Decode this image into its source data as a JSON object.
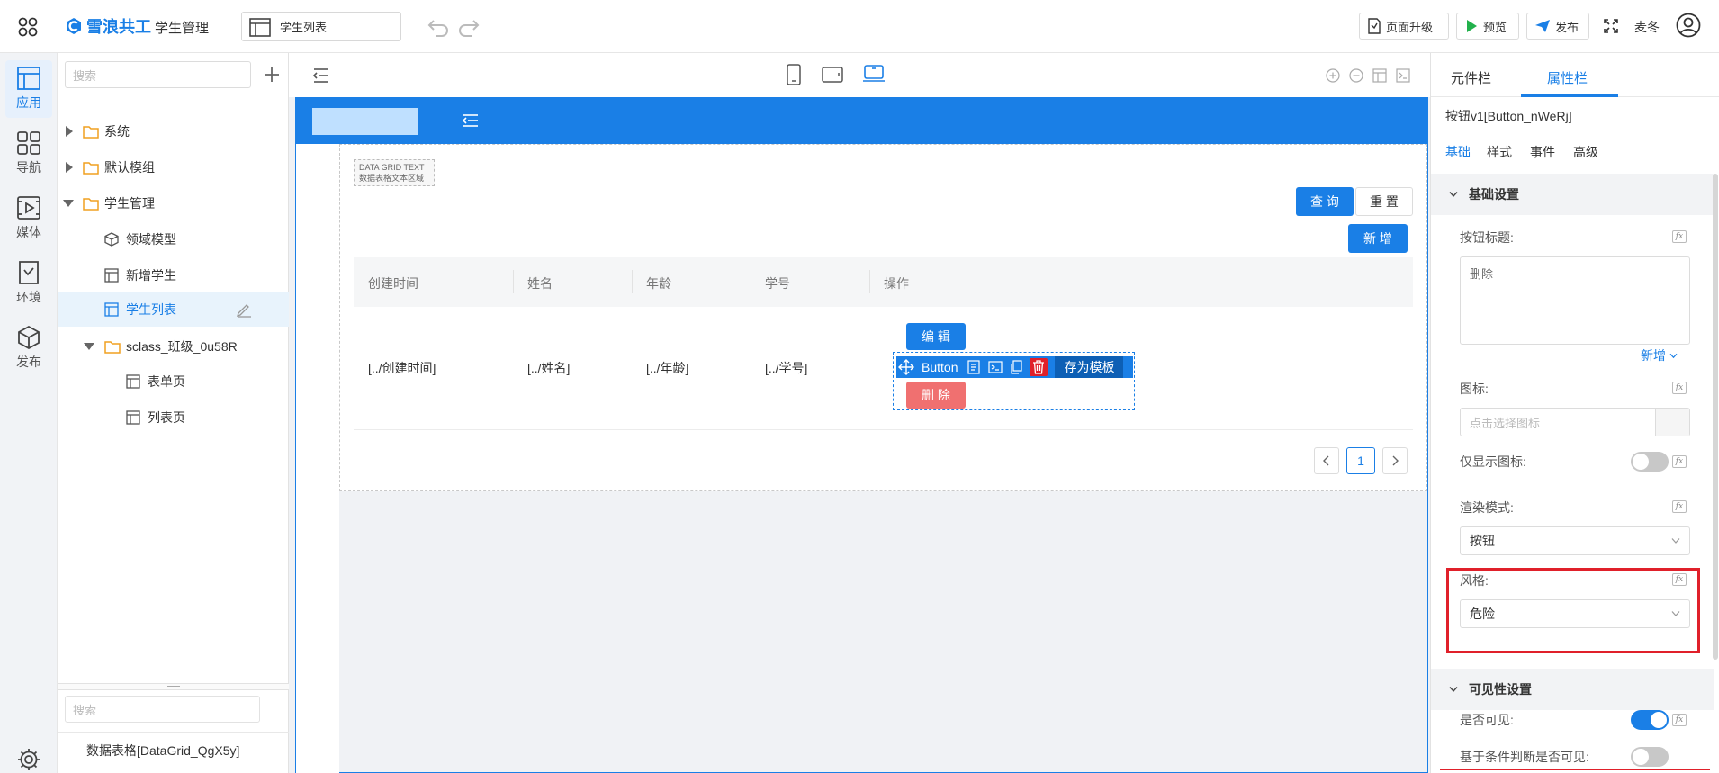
{
  "header": {
    "brand": "雪浪共工",
    "module": "学生管理",
    "page_select": "学生列表",
    "upgrade_label": "页面升级",
    "preview_label": "预览",
    "publish_label": "发布",
    "user_name": "麦冬"
  },
  "rail": {
    "items": [
      {
        "label": "应用",
        "icon": "app-icon"
      },
      {
        "label": "导航",
        "icon": "nav-grid-icon"
      },
      {
        "label": "媒体",
        "icon": "media-icon"
      },
      {
        "label": "环境",
        "icon": "env-icon"
      },
      {
        "label": "发布",
        "icon": "cube-icon"
      }
    ],
    "settings_icon": "gear-icon"
  },
  "tree": {
    "search_placeholder": "搜索",
    "items": [
      {
        "label": "系统",
        "type": "folder",
        "expanded": false
      },
      {
        "label": "默认模组",
        "type": "folder",
        "expanded": false
      },
      {
        "label": "学生管理",
        "type": "folder",
        "expanded": true
      },
      {
        "label": "领域模型",
        "type": "model"
      },
      {
        "label": "新增学生",
        "type": "page"
      },
      {
        "label": "学生列表",
        "type": "page",
        "selected": true
      },
      {
        "label": "sclass_班级_0u58R",
        "type": "folder",
        "expanded": true
      },
      {
        "label": "表单页",
        "type": "page"
      },
      {
        "label": "列表页",
        "type": "page"
      }
    ],
    "bottom_search_placeholder": "搜索",
    "bottom_item": "数据表格[DataGrid_QgX5y]"
  },
  "canvas": {
    "grid_text_title": "DATA GRID TEXT",
    "grid_text_sub": "数据表格文本区域",
    "query_btn": "查 询",
    "reset_btn": "重 置",
    "add_btn": "新 增",
    "columns": [
      "创建时间",
      "姓名",
      "年龄",
      "学号",
      "操作"
    ],
    "row": [
      "[../创建时间]",
      "[../姓名]",
      "[../年龄]",
      "[../学号]"
    ],
    "edit_btn": "编 辑",
    "delete_btn": "删 除",
    "toolbar_button_label": "Button",
    "save_template": "存为模板",
    "page_current": "1"
  },
  "rpanel": {
    "tabs": [
      "元件栏",
      "属性栏"
    ],
    "active_tab": "属性栏",
    "component_name": "按钮v1[Button_nWeRj]",
    "sub_tabs": [
      "基础",
      "样式",
      "事件",
      "高级"
    ],
    "section_basic": "基础设置",
    "button_title_label": "按钮标题:",
    "button_title_value": "删除",
    "add_link": "新增",
    "icon_label": "图标:",
    "icon_placeholder": "点击选择图标",
    "icon_only_label": "仅显示图标:",
    "render_mode_label": "渲染模式:",
    "render_mode_value": "按钮",
    "style_label": "风格:",
    "style_value": "危险",
    "section_visibility": "可见性设置",
    "visible_label": "是否可见:",
    "cond_visible_label": "基于条件判断是否可见:",
    "fx": "fx"
  },
  "colors": {
    "primary": "#1a7fe6",
    "danger": "#f07070",
    "highlight": "#e0202a"
  }
}
